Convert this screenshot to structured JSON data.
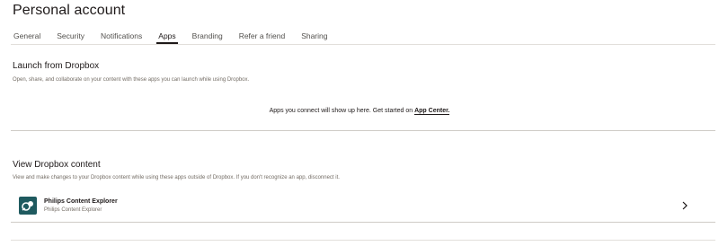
{
  "page": {
    "title": "Personal account"
  },
  "tabs": [
    {
      "label": "General",
      "active": false
    },
    {
      "label": "Security",
      "active": false
    },
    {
      "label": "Notifications",
      "active": false
    },
    {
      "label": "Apps",
      "active": true
    },
    {
      "label": "Branding",
      "active": false
    },
    {
      "label": "Refer a friend",
      "active": false
    },
    {
      "label": "Sharing",
      "active": false
    }
  ],
  "launch": {
    "title": "Launch from Dropbox",
    "description": "Open, share, and collaborate on your content with these apps you can launch while using Dropbox.",
    "empty_text": "Apps you connect will show up here. Get started on ",
    "link_text": "App Center."
  },
  "view": {
    "title": "View Dropbox content",
    "description": "View and make changes to your Dropbox content while using these apps outside of Dropbox. If you don't recognize an app, disconnect it.",
    "apps": [
      {
        "name": "Philips Content Explorer",
        "subtitle": "Philips Content Explorer",
        "icon": "philips-app-icon"
      }
    ]
  },
  "colors": {
    "text": "#1e1919",
    "muted": "#736c64",
    "app_icon_bg": "#1f5a5f",
    "rule": "#cfcbc6"
  }
}
